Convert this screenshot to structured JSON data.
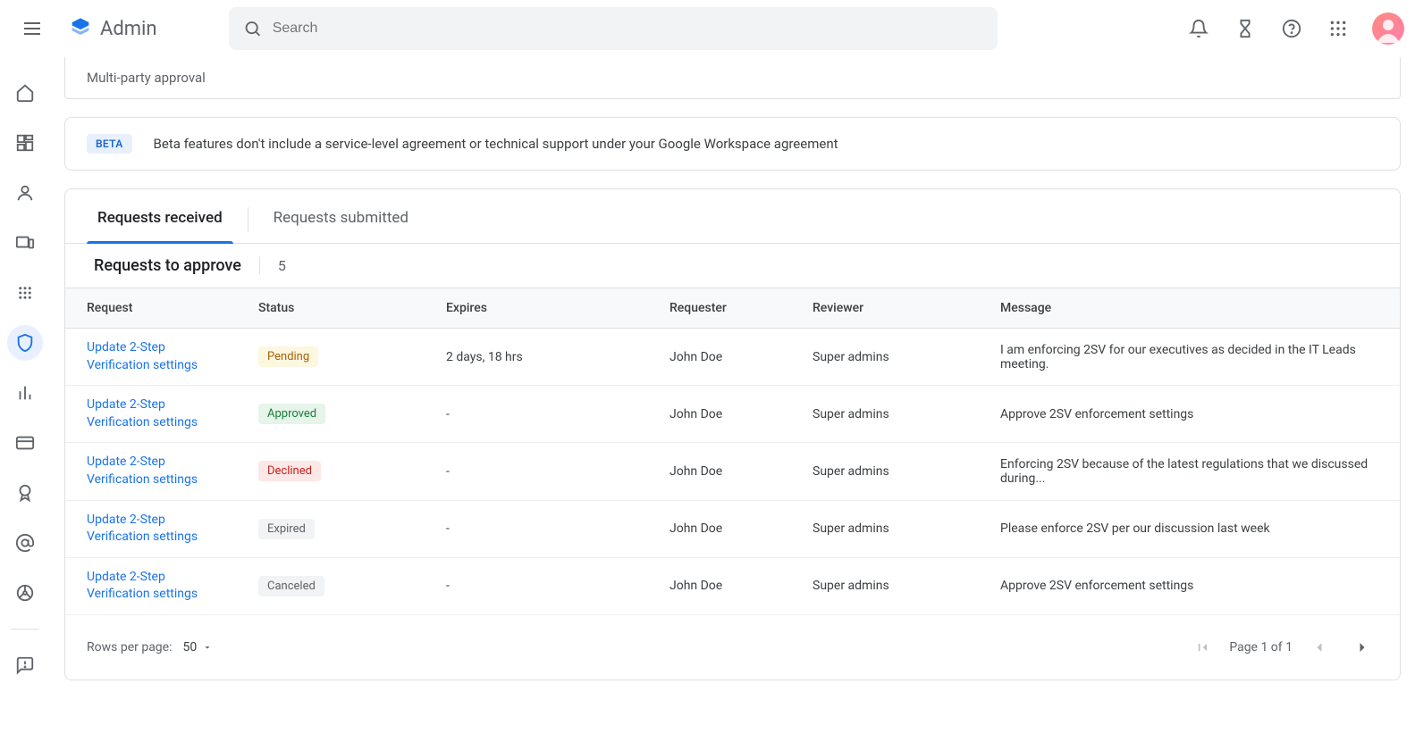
{
  "header": {
    "app_name": "Admin",
    "search_placeholder": "Search"
  },
  "breadcrumb": "Multi-party approval",
  "beta": {
    "badge": "BETA",
    "text": "Beta features don't include a service-level agreement or technical support under your Google Workspace agreement"
  },
  "tabs": {
    "received": "Requests received",
    "submitted": "Requests submitted"
  },
  "subheader": {
    "title": "Requests to approve",
    "count": "5"
  },
  "columns": {
    "request": "Request",
    "status": "Status",
    "expires": "Expires",
    "requester": "Requester",
    "reviewer": "Reviewer",
    "message": "Message"
  },
  "rows": [
    {
      "request": "Update 2-Step Verification settings",
      "status": "Pending",
      "status_class": "pending",
      "expires": "2 days, 18 hrs",
      "requester": "John Doe",
      "reviewer": "Super admins",
      "message": "I am enforcing 2SV for our executives as decided in the IT Leads meeting."
    },
    {
      "request": "Update 2-Step Verification settings",
      "status": "Approved",
      "status_class": "approved",
      "expires": "-",
      "requester": "John Doe",
      "reviewer": "Super admins",
      "message": "Approve 2SV enforcement settings"
    },
    {
      "request": "Update 2-Step Verification settings",
      "status": "Declined",
      "status_class": "declined",
      "expires": "-",
      "requester": "John Doe",
      "reviewer": "Super admins",
      "message": "Enforcing 2SV because of the latest regulations that we discussed during..."
    },
    {
      "request": "Update 2-Step Verification settings",
      "status": "Expired",
      "status_class": "expired",
      "expires": "-",
      "requester": "John Doe",
      "reviewer": "Super admins",
      "message": "Please enforce 2SV per our discussion last week"
    },
    {
      "request": "Update 2-Step Verification settings",
      "status": "Canceled",
      "status_class": "canceled",
      "expires": "-",
      "requester": "John Doe",
      "reviewer": "Super admins",
      "message": "Approve 2SV enforcement settings"
    }
  ],
  "footer": {
    "rows_label": "Rows per page:",
    "rows_value": "50",
    "page_text": "Page 1 of 1"
  }
}
